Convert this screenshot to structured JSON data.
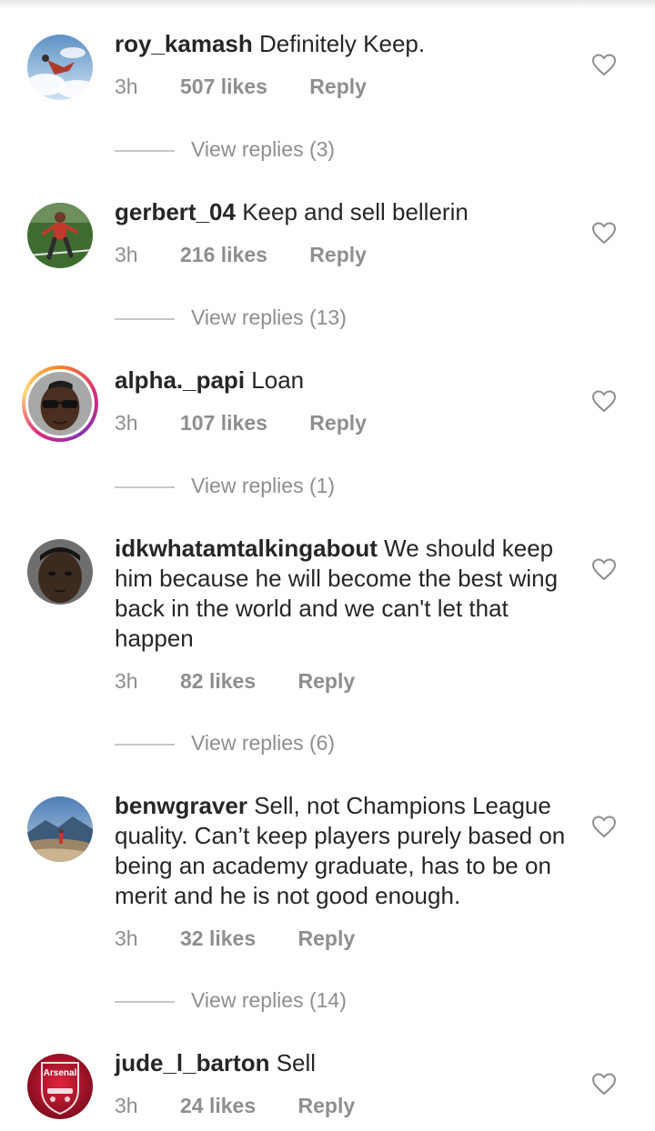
{
  "comments": [
    {
      "username": "roy_kamash",
      "text": "Definitely Keep.",
      "time": "3h",
      "likes": "507 likes",
      "reply": "Reply",
      "view_replies": "View replies (3)",
      "avatar_icon": "skydiver-photo",
      "colors": {
        "bg1": "#8fb7d8",
        "bg2": "#ffffff",
        "accent": "#c0392b"
      }
    },
    {
      "username": "gerbert_04",
      "text": "Keep and sell bellerin",
      "time": "3h",
      "likes": "216 likes",
      "reply": "Reply",
      "view_replies": "View replies (13)",
      "avatar_icon": "football-player-photo",
      "colors": {
        "bg1": "#4e7a3c",
        "bg2": "#2f5424",
        "accent": "#c0392b"
      }
    },
    {
      "username": "alpha._papi",
      "text": "Loan",
      "time": "3h",
      "likes": "107 likes",
      "reply": "Reply",
      "view_replies": "View replies (1)",
      "avatar_icon": "person-sunglasses-photo",
      "colors": {
        "bg1": "#9a9a9a",
        "bg2": "#5a3b2a",
        "accent": "#111111"
      }
    },
    {
      "username": "idkwhatamtalkingabout",
      "text": "We should keep him because he will become the best wing back in the world and we can't let that happen",
      "time": "3h",
      "likes": "82 likes",
      "reply": "Reply",
      "view_replies": "View replies (6)",
      "avatar_icon": "person-face-photo",
      "colors": {
        "bg1": "#6b6b6b",
        "bg2": "#3b2a20",
        "accent": "#222222"
      }
    },
    {
      "username": "benwgraver",
      "text": "Sell, not Champions League quality. Can’t keep players purely based on being an academy graduate, has to be on merit and he is not good enough.",
      "time": "3h",
      "likes": "32 likes",
      "reply": "Reply",
      "view_replies": "View replies (14)",
      "avatar_icon": "mountain-landscape-photo",
      "colors": {
        "bg1": "#7fa6cf",
        "bg2": "#8c7a5e",
        "accent": "#d35400"
      }
    },
    {
      "username": "jude_l_barton",
      "text": "Sell",
      "time": "3h",
      "likes": "24 likes",
      "reply": "Reply",
      "avatar_icon": "arsenal-crest-icon",
      "avatar_label": "Arsenal",
      "colors": {
        "bg1": "#c8102e",
        "bg2": "#7a0a1c",
        "accent": "#ffffff"
      }
    }
  ],
  "icons": {
    "like": "heart-outline-icon"
  },
  "colors": {
    "text": "#262626",
    "meta": "#8e8e8e",
    "divider": "#c7c7c7"
  }
}
